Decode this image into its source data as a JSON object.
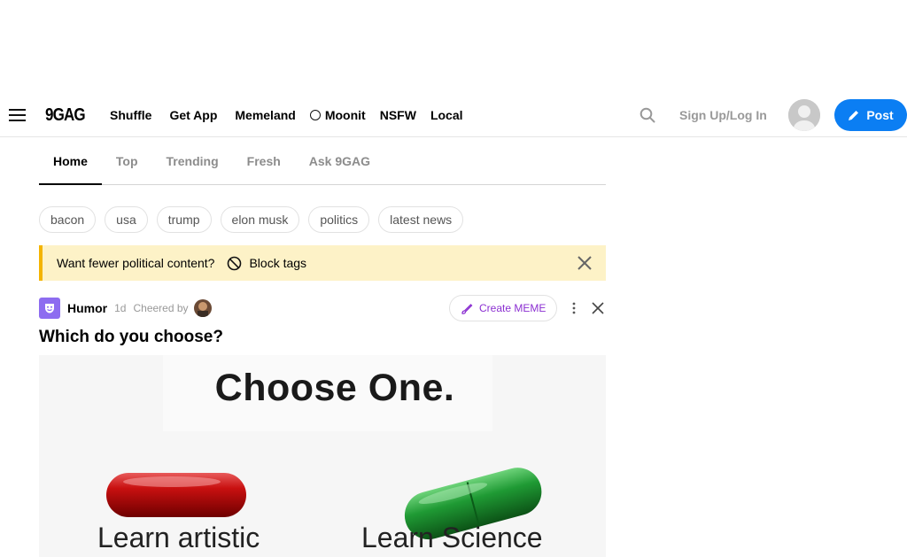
{
  "header": {
    "logo": "9GAG",
    "nav": [
      {
        "icon": "shuffle-icon",
        "glyph": "",
        "label": "Shuffle"
      },
      {
        "icon": "get-app-icon",
        "glyph": "",
        "label": "Get App"
      },
      {
        "icon": "memeland-icon",
        "glyph": "",
        "label": "Memeland"
      },
      {
        "icon": "moonit-icon",
        "glyph": "",
        "label": "Moonit"
      },
      {
        "icon": "nsfw-icon",
        "glyph": "",
        "label": "NSFW"
      },
      {
        "icon": "local-icon",
        "glyph": "",
        "label": "Local"
      }
    ],
    "signup_label": "Sign Up/Log In",
    "post_label": "Post",
    "accent": "#0b7ef3"
  },
  "tabs": [
    {
      "label": "Home",
      "active": true
    },
    {
      "label": "Top"
    },
    {
      "label": "Trending"
    },
    {
      "label": "Fresh"
    },
    {
      "label": "Ask 9GAG"
    }
  ],
  "tags": [
    "bacon",
    "usa",
    "trump",
    "elon musk",
    "politics",
    "latest news"
  ],
  "banner": {
    "text": "Want fewer political content?",
    "action_label": "Block tags",
    "bg": "#fdf2c7"
  },
  "post": {
    "section": "Humor",
    "age": "1d",
    "cheered_by": "Cheered by",
    "create_meme_label": "Create MEME",
    "title": "Which do you choose?",
    "image": {
      "heading": "Choose One.",
      "left_caption": "Learn artistic",
      "right_caption": "Learn Science"
    }
  }
}
